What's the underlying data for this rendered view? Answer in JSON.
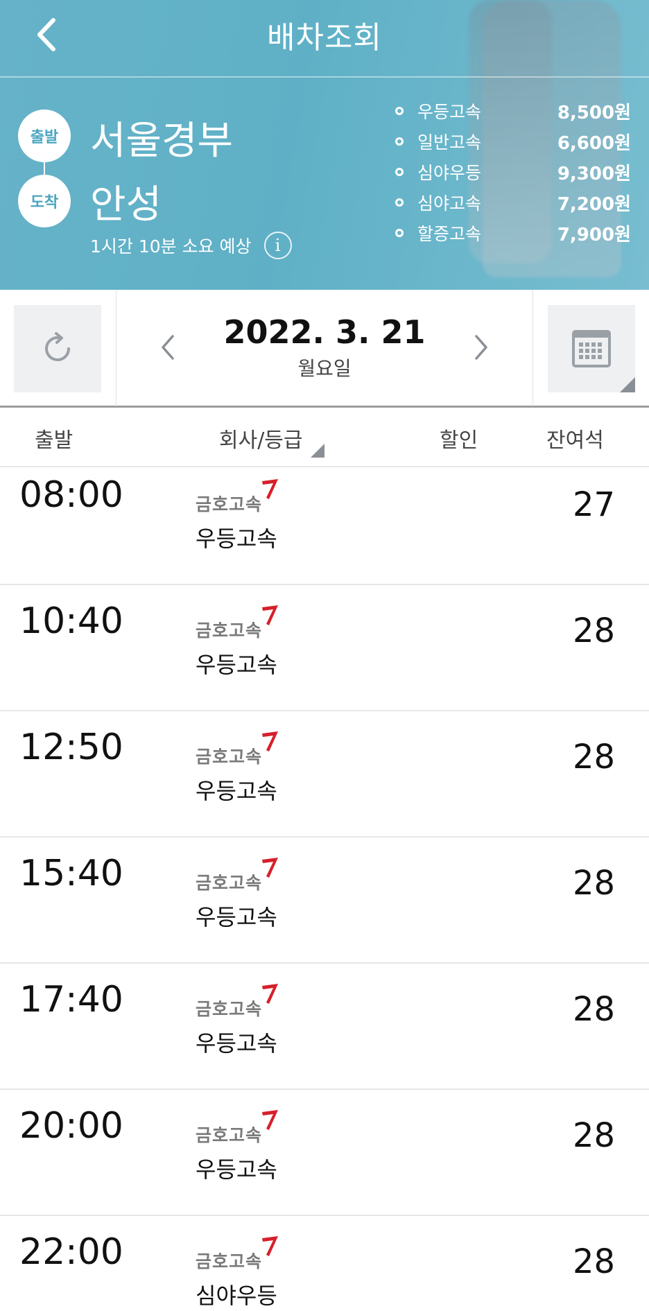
{
  "header": {
    "title": "배차조회",
    "departure_badge": "출발",
    "arrival_badge": "도착",
    "departure_station": "서울경부",
    "arrival_station": "안성",
    "duration": "1시간 10분 소요 예상",
    "fares": [
      {
        "grade": "우등고속",
        "price": "8,500원"
      },
      {
        "grade": "일반고속",
        "price": "6,600원"
      },
      {
        "grade": "심야우등",
        "price": "9,300원"
      },
      {
        "grade": "심야고속",
        "price": "7,200원"
      },
      {
        "grade": "할증고속",
        "price": "7,900원"
      }
    ]
  },
  "datebar": {
    "date": "2022. 3. 21",
    "weekday": "월요일"
  },
  "columns": {
    "depart": "출발",
    "company": "회사/등급",
    "discount": "할인",
    "seats": "잔여석"
  },
  "schedule": [
    {
      "time": "08:00",
      "company": "금호고속",
      "grade": "우등고속",
      "seats": "27"
    },
    {
      "time": "10:40",
      "company": "금호고속",
      "grade": "우등고속",
      "seats": "28"
    },
    {
      "time": "12:50",
      "company": "금호고속",
      "grade": "우등고속",
      "seats": "28"
    },
    {
      "time": "15:40",
      "company": "금호고속",
      "grade": "우등고속",
      "seats": "28"
    },
    {
      "time": "17:40",
      "company": "금호고속",
      "grade": "우등고속",
      "seats": "28"
    },
    {
      "time": "20:00",
      "company": "금호고속",
      "grade": "우등고속",
      "seats": "28"
    },
    {
      "time": "22:00",
      "company": "금호고속",
      "grade": "심야우등",
      "seats": "28"
    }
  ],
  "icons": {
    "back": "chevron-left-icon",
    "info": "info-icon",
    "refresh": "refresh-icon",
    "prev": "chevron-left-icon",
    "next": "chevron-right-icon",
    "calendar": "calendar-icon",
    "logo_mark": "kumho-logo-icon"
  },
  "colors": {
    "header_bg": "#5fb0c6",
    "badge_text": "#4aa6c0",
    "logo_red": "#d6202b",
    "logo_gray": "#7a7a7a"
  }
}
